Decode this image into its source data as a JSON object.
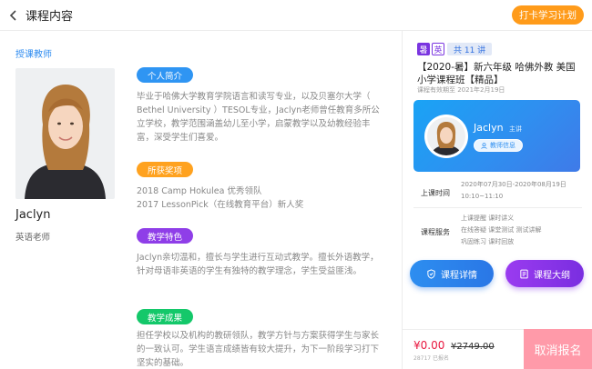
{
  "header": {
    "title": "课程内容",
    "plan_button": "打卡学习计划"
  },
  "teacher": {
    "section_title": "授课教师",
    "name": "Jaclyn",
    "role": "英语老师",
    "sections": [
      {
        "tag": "个人简介",
        "text": "毕业于哈佛大学教育学院语言和读写专业，以及贝塞尔大学（ Bethel University ）TESOL专业，Jaclyn老师曾任教育多所公立学校，教学范围涵盖幼儿至小学，启蒙教学以及幼教经验丰富，深受学生们喜爱。"
      },
      {
        "tag": "所获奖项",
        "lines": [
          "2018 Camp Hokulea 优秀领队",
          "2017 LessonPick（在线教育平台）新人奖"
        ]
      },
      {
        "tag": "教学特色",
        "text": "Jaclyn亲切温和，擅长与学生进行互动式教学。擅长外语教学，针对母语非英语的学生有独特的教学理念，学生受益匪浅。"
      },
      {
        "tag": "教学成果",
        "text": "担任学校以及机构的教研领队，教学方针与方案获得学生与家长的一致认可。学生语言成绩皆有较大提升，为下一阶段学习打下坚实的基础。"
      }
    ]
  },
  "course": {
    "badge_season": "暑",
    "badge_subject": "英",
    "badge_lessons": "共 11 讲",
    "title": "【2020-暑】新六年级 哈佛外教 美国小学课程班【精品】",
    "valid": "课程有效期至 2021年2月19日",
    "banner": {
      "name": "Jaclyn",
      "role": "主讲",
      "info_button": "教师信息"
    },
    "time_label": "上课时间",
    "time_value": [
      "2020年07月30日-2020年08月19日",
      "10:10~11:10"
    ],
    "service_label": "课程服务",
    "service_value": [
      "上课提醒  课时讲义",
      "在线答疑  课堂测试  测试讲解",
      "巩固练习  课时回放"
    ],
    "detail_button": "课程详情",
    "outline_button": "课程大纲",
    "price": "¥0.00",
    "old_price": "¥2749.00",
    "sold": "28717 已报名",
    "cancel_button": "取消报名"
  },
  "colors": {
    "accent_blue": "#2f95f3",
    "orange": "#ff9b1a",
    "purple": "#8f3ee8",
    "green": "#14c86a",
    "price_red": "#e8173f",
    "cancel_pink": "#ff9aa9"
  },
  "icons": {
    "back": "chevron-left-icon",
    "info": "user-icon",
    "detail": "shield-icon",
    "outline": "document-icon"
  }
}
